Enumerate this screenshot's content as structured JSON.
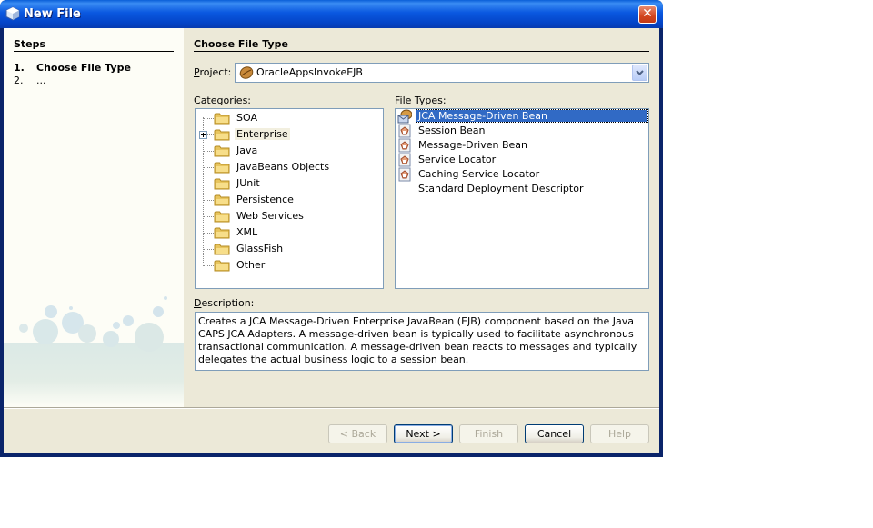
{
  "window": {
    "title": "New File",
    "close_label": "✕"
  },
  "steps": {
    "title": "Steps",
    "items": [
      {
        "num": "1.",
        "label": "Choose File Type",
        "current": true
      },
      {
        "num": "2.",
        "label": "...",
        "current": false
      }
    ]
  },
  "main": {
    "title": "Choose File Type",
    "project": {
      "label_mnemonic": "P",
      "label_rest": "roject:",
      "value": "OracleAppsInvokeEJB",
      "icon": "coffee-bean-icon"
    },
    "categories": {
      "label_mnemonic": "C",
      "label_rest": "ategories:",
      "items": [
        {
          "label": "SOA",
          "expandable": false,
          "selected": false
        },
        {
          "label": "Enterprise",
          "expandable": true,
          "selected": true
        },
        {
          "label": "Java",
          "expandable": false,
          "selected": false
        },
        {
          "label": "JavaBeans Objects",
          "expandable": false,
          "selected": false
        },
        {
          "label": "JUnit",
          "expandable": false,
          "selected": false
        },
        {
          "label": "Persistence",
          "expandable": false,
          "selected": false
        },
        {
          "label": "Web Services",
          "expandable": false,
          "selected": false
        },
        {
          "label": "XML",
          "expandable": false,
          "selected": false
        },
        {
          "label": "GlassFish",
          "expandable": false,
          "selected": false
        },
        {
          "label": "Other",
          "expandable": false,
          "selected": false
        }
      ]
    },
    "file_types": {
      "label_mnemonic": "F",
      "label_rest": "ile Types:",
      "items": [
        {
          "label": "JCA Message-Driven Bean",
          "icon": "jca-bean-icon",
          "selected": true
        },
        {
          "label": "Session Bean",
          "icon": "ejb-icon",
          "selected": false
        },
        {
          "label": "Message-Driven Bean",
          "icon": "ejb-icon",
          "selected": false
        },
        {
          "label": "Service Locator",
          "icon": "ejb-icon",
          "selected": false
        },
        {
          "label": "Caching Service Locator",
          "icon": "ejb-icon",
          "selected": false
        },
        {
          "label": "Standard Deployment Descriptor",
          "icon": "none",
          "selected": false
        }
      ]
    },
    "description": {
      "label_mnemonic": "D",
      "label_rest": "escription:",
      "text": "Creates a JCA Message-Driven Enterprise JavaBean (EJB) component based on the Java CAPS JCA Adapters. A message-driven bean is typically used to facilitate asynchronous transactional communication. A message-driven bean reacts to messages and typically delegates the actual business logic to a session bean."
    }
  },
  "buttons": {
    "back": {
      "label": "< Back",
      "enabled": false
    },
    "next": {
      "label": "Next >",
      "enabled": true
    },
    "finish": {
      "label": "Finish",
      "enabled": false
    },
    "cancel": {
      "label": "Cancel",
      "enabled": true
    },
    "help": {
      "label": "Help",
      "enabled": false
    }
  },
  "colors": {
    "title_bar": "#0a58e0",
    "dialog_bg": "#ece9d8",
    "selection": "#316ac5",
    "field_border": "#7f9db9"
  }
}
